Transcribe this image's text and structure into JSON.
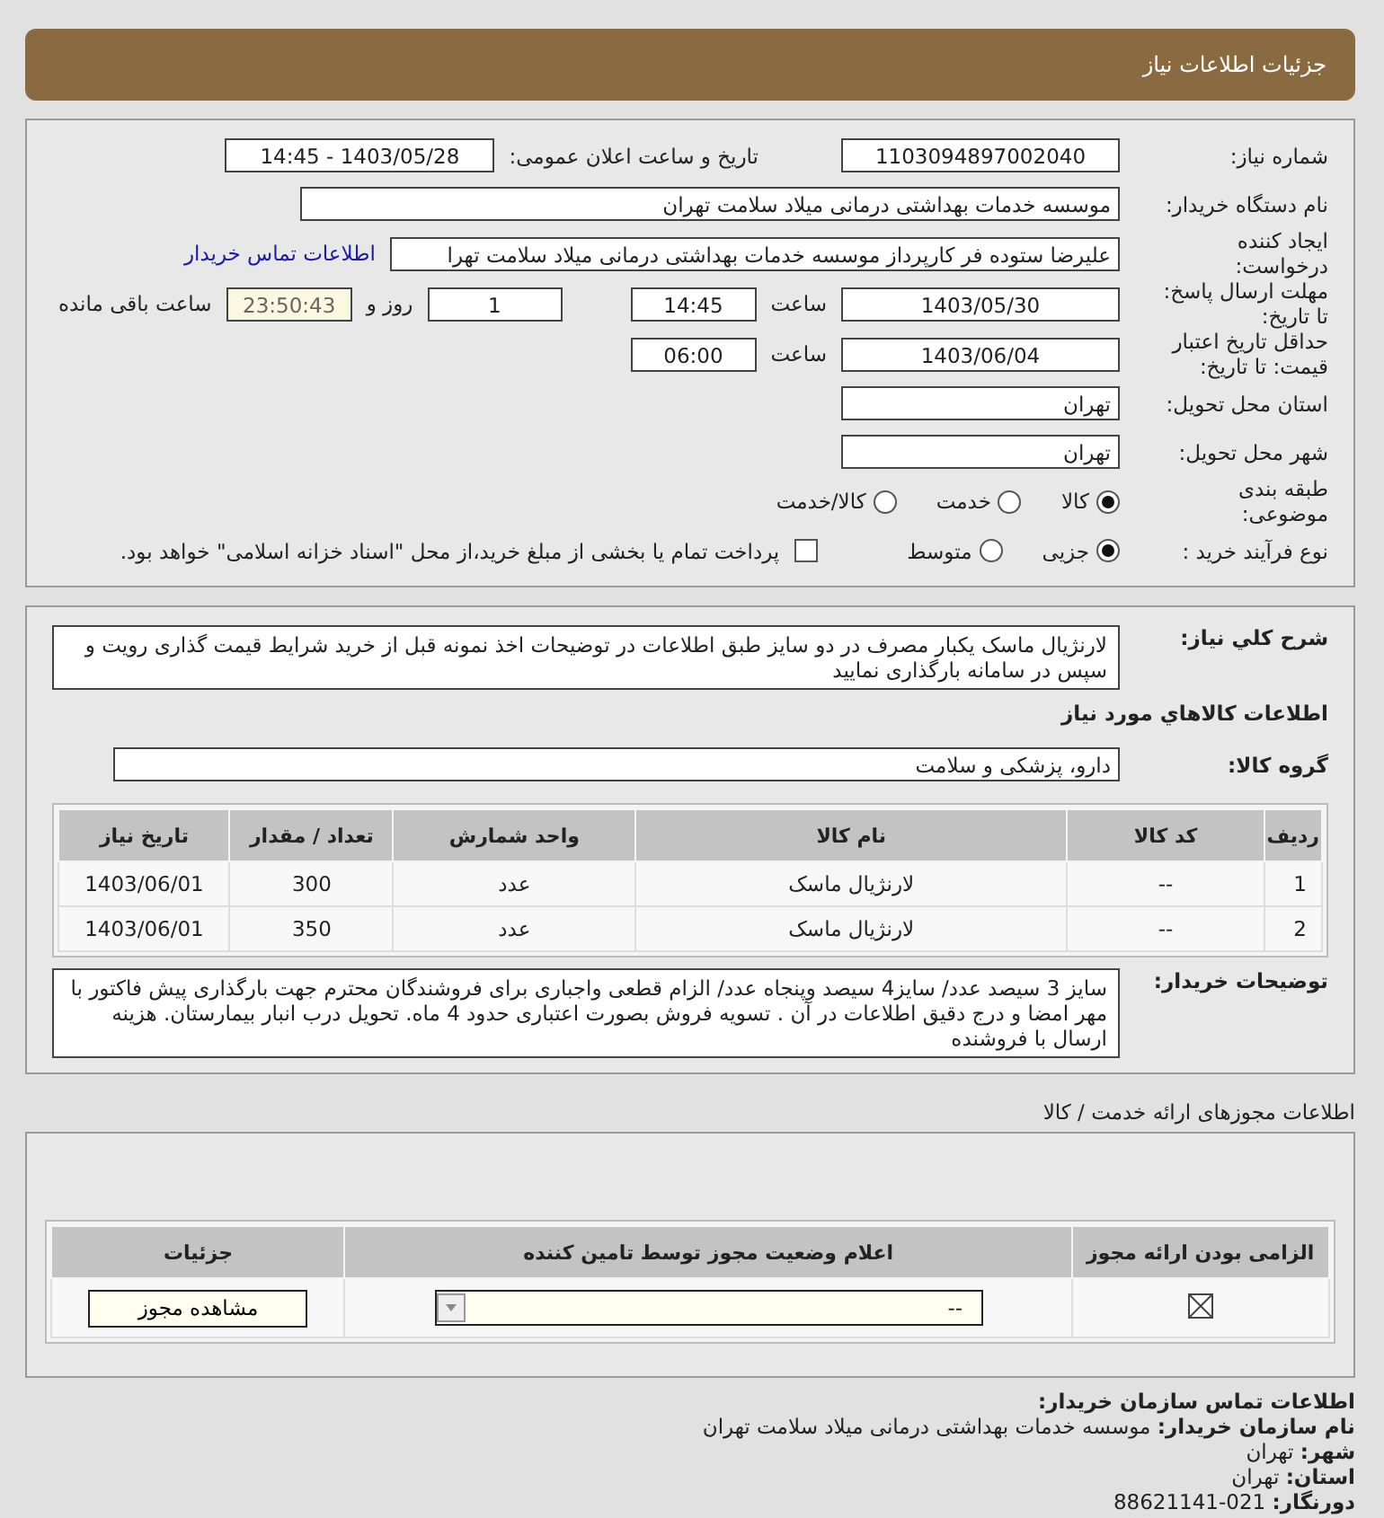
{
  "title": "جزئیات اطلاعات نیاز",
  "need": {
    "number": {
      "label": "شماره نیاز:",
      "value": "1103094897002040"
    },
    "announce": {
      "label": "تاریخ و ساعت اعلان عمومی:",
      "value": "1403/05/28 - 14:45"
    },
    "buyer": {
      "label": "نام دستگاه خریدار:",
      "value": "موسسه خدمات بهداشتی درمانی میلاد سلامت تهران"
    },
    "requester": {
      "label": "ایجاد کننده درخواست:",
      "value": "علیرضا ستوده فر کارپرداز موسسه خدمات بهداشتی درمانی میلاد سلامت تهرا",
      "link": "اطلاعات تماس خریدار"
    },
    "deadline": {
      "label": "مهلت ارسال پاسخ: تا تاریخ:",
      "date": "1403/05/30",
      "time_label": "ساعت",
      "time": "14:45",
      "days": "1",
      "days_label": "روز و",
      "remaining": "23:50:43",
      "remaining_label": "ساعت باقی مانده"
    },
    "validity": {
      "label": "حداقل تاریخ اعتبار قیمت: تا تاریخ:",
      "date": "1403/06/04",
      "time_label": "ساعت",
      "time": "06:00"
    },
    "province": {
      "label": "استان محل تحویل:",
      "value": "تهران"
    },
    "city": {
      "label": "شهر محل تحویل:",
      "value": "تهران"
    },
    "category": {
      "label": "طبقه بندی موضوعی:",
      "options": [
        {
          "label": "کالا",
          "selected": true
        },
        {
          "label": "خدمت",
          "selected": false
        },
        {
          "label": "کالا/خدمت",
          "selected": false
        }
      ]
    },
    "process": {
      "label": "نوع فرآیند خرید :",
      "options": [
        {
          "label": "جزیی",
          "selected": true
        },
        {
          "label": "متوسط",
          "selected": false
        }
      ],
      "treasury": {
        "label": "پرداخت تمام یا بخشی از مبلغ خرید،از محل \"اسناد خزانه اسلامی\" خواهد بود.",
        "checked": false
      }
    }
  },
  "goods": {
    "summary": {
      "label": "شرح کلي نياز:",
      "value": "لارنژیال ماسک یکبار مصرف در دو سایز طبق اطلاعات در توضیحات اخذ نمونه قبل از خرید شرایط قیمت گذاری رویت و سپس در سامانه بارگذاری نمایید"
    },
    "heading": "اطلاعات کالاهاي مورد نياز",
    "group": {
      "label": "گروه کالا:",
      "value": "دارو، پزشکی و سلامت"
    },
    "table": {
      "columns": [
        "ردیف",
        "کد کالا",
        "نام کالا",
        "واحد شمارش",
        "تعداد / مقدار",
        "تاریخ نیاز"
      ],
      "rows": [
        [
          "1",
          "--",
          "لارنژیال ماسک",
          "عدد",
          "300",
          "1403/06/01"
        ],
        [
          "2",
          "--",
          "لارنژیال ماسک",
          "عدد",
          "350",
          "1403/06/01"
        ]
      ]
    },
    "notes": {
      "label": "توضیحات خریدار:",
      "value": "سایز 3 سیصد عدد/ سایز4 سیصد وپنجاه عدد/ الزام قطعی واجباری برای فروشندگان محترم جهت بارگذاری پیش فاکتور با مهر امضا و درج دقیق اطلاعات در آن . تسویه فروش بصورت اعتباری حدود 4 ماه. تحویل درب انبار بیمارستان. هزینه ارسال با فروشنده"
    }
  },
  "licenses": {
    "title": "اطلاعات مجوزهای ارائه خدمت / کالا",
    "columns": [
      "الزامی بودن ارائه مجوز",
      "اعلام وضعیت مجوز توسط تامین کننده",
      "جزئیات"
    ],
    "rows": [
      {
        "required": true,
        "status": "--",
        "button": "مشاهده مجوز"
      }
    ]
  },
  "contact": {
    "title": "اطلاعات تماس سازمان خریدار:",
    "lines": [
      {
        "label": "نام سازمان خریدار:",
        "value": "موسسه خدمات بهداشتی درمانی میلاد سلامت تهران"
      },
      {
        "label": "شهر:",
        "value": "تهران"
      },
      {
        "label": "استان:",
        "value": "تهران"
      },
      {
        "label": "دورنگار:",
        "value": "021-88621141"
      }
    ]
  }
}
